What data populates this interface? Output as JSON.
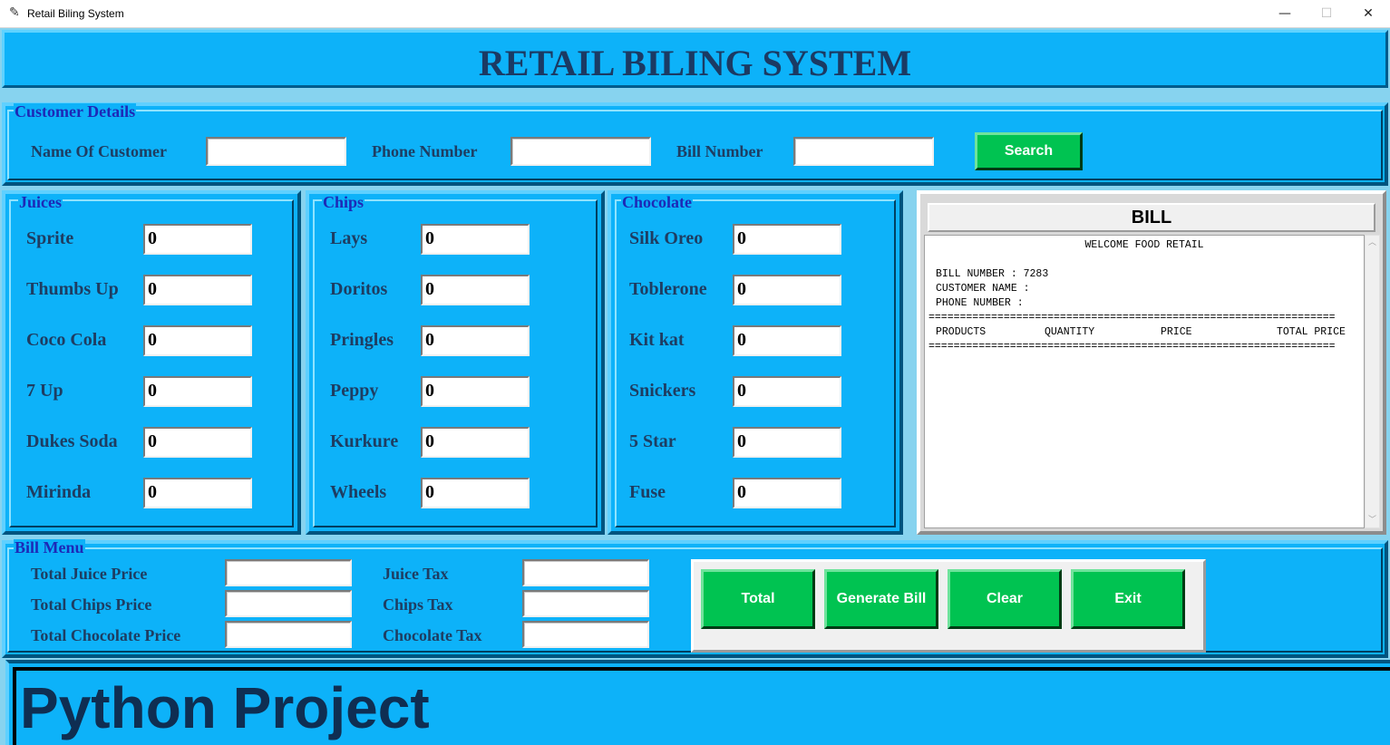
{
  "window": {
    "title": "Retail Biling System",
    "minimize_glyph": "—",
    "maximize_glyph": "☐",
    "close_glyph": "✕",
    "app_icon": "feather-icon"
  },
  "header": {
    "title": "RETAIL BILING SYSTEM"
  },
  "customer": {
    "legend": "Customer Details",
    "name_label": "Name Of Customer",
    "name_value": "",
    "phone_label": "Phone Number",
    "phone_value": "",
    "bill_label": "Bill Number",
    "bill_value": "",
    "search_label": "Search"
  },
  "juices": {
    "legend": "Juices",
    "items": [
      {
        "label": "Sprite",
        "qty": "0"
      },
      {
        "label": "Thumbs Up",
        "qty": "0"
      },
      {
        "label": "Coco Cola",
        "qty": "0"
      },
      {
        "label": "7 Up",
        "qty": "0"
      },
      {
        "label": "Dukes Soda",
        "qty": "0"
      },
      {
        "label": "Mirinda",
        "qty": "0"
      }
    ]
  },
  "chips": {
    "legend": "Chips",
    "items": [
      {
        "label": "Lays",
        "qty": "0"
      },
      {
        "label": "Doritos",
        "qty": "0"
      },
      {
        "label": "Pringles",
        "qty": "0"
      },
      {
        "label": "Peppy",
        "qty": "0"
      },
      {
        "label": "Kurkure",
        "qty": "0"
      },
      {
        "label": "Wheels",
        "qty": "0"
      }
    ]
  },
  "chocolate": {
    "legend": "Chocolate",
    "items": [
      {
        "label": "Silk Oreo",
        "qty": "0"
      },
      {
        "label": "Toblerone",
        "qty": "0"
      },
      {
        "label": "Kit kat",
        "qty": "0"
      },
      {
        "label": "Snickers",
        "qty": "0"
      },
      {
        "label": "5 Star",
        "qty": "0"
      },
      {
        "label": "Fuse",
        "qty": "0"
      }
    ]
  },
  "bill": {
    "heading": "BILL",
    "welcome": "WELCOME FOOD RETAIL",
    "bill_number_line": "BILL NUMBER : 7283",
    "customer_name_line": "CUSTOMER NAME :",
    "phone_number_line": "PHONE NUMBER :",
    "separator": "=================================================================",
    "col_products": "PRODUCTS",
    "col_quantity": "QUANTITY",
    "col_price": "PRICE",
    "col_total": "TOTAL PRICE"
  },
  "bill_menu": {
    "legend": "Bill Menu",
    "total_juice_label": "Total Juice Price",
    "total_juice_value": "",
    "total_chips_label": "Total Chips Price",
    "total_chips_value": "",
    "total_chocolate_label": "Total Chocolate Price",
    "total_chocolate_value": "",
    "juice_tax_label": "Juice Tax",
    "juice_tax_value": "",
    "chips_tax_label": "Chips Tax",
    "chips_tax_value": "",
    "chocolate_tax_label": "Chocolate Tax",
    "chocolate_tax_value": "",
    "buttons": {
      "total": "Total",
      "generate": "Generate Bill",
      "clear": "Clear",
      "exit": "Exit"
    }
  },
  "footer": {
    "text": "Python Project"
  },
  "colors": {
    "panel_bg": "#0db2f9",
    "button_green": "#00c351",
    "title_text": "#1b3a63",
    "legend_text": "#1d29b7"
  }
}
